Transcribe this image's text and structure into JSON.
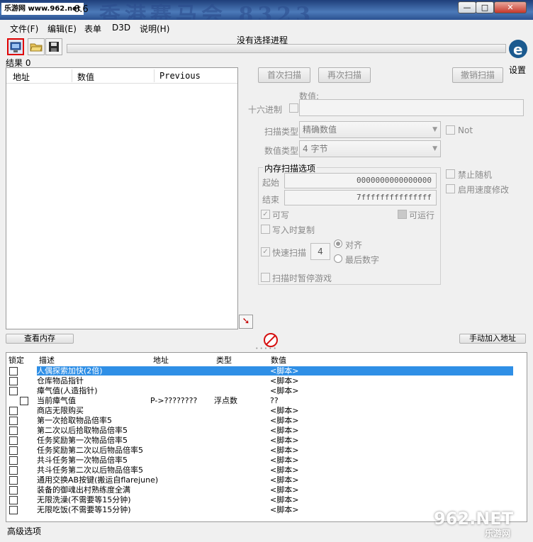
{
  "titlebar": {
    "watermark": "乐游网 www.962.net",
    "version": "6.6",
    "banner": "香港赛马会  8323"
  },
  "window": {
    "min": "—",
    "max": "□",
    "close": "✕"
  },
  "menu": [
    "文件(F)",
    "编辑(E)",
    "表单",
    "D3D",
    "说明(H)"
  ],
  "process_label": "没有选择进程",
  "settings_label": "设置",
  "result_count": "结果 0",
  "scan_list": {
    "col_address": "地址",
    "col_value": "数值",
    "col_previous": "Previous"
  },
  "buttons": {
    "first_scan": "首次扫描",
    "next_scan": "再次扫描",
    "undo_scan": "撤销扫描",
    "view_memory": "查看内存",
    "manual_add": "手动加入地址"
  },
  "scan": {
    "value_label": "数值:",
    "hex_label": "十六进制",
    "scan_type_label": "扫描类型",
    "scan_type_value": "精确数值",
    "value_type_label": "数值类型",
    "value_type_value": "4 字节",
    "not_label": "Not",
    "disable_random": "禁止随机",
    "speedhack": "启用速度修改"
  },
  "memory": {
    "title": "内存扫描选项",
    "start_label": "起始",
    "start_value": "0000000000000000",
    "end_label": "结束",
    "end_value": "7fffffffffffffff",
    "writable": "可写",
    "executable": "可运行",
    "copy_on_write": "写入时复制",
    "fast_scan": "快速扫描",
    "fast_scan_value": "4",
    "align": "对齐",
    "last_digits": "最后数字",
    "pause": "扫描时暂停游戏"
  },
  "cheat_table": {
    "headers": {
      "active": "锁定",
      "description": "描述",
      "address": "地址",
      "type": "类型",
      "value": "数值"
    },
    "rows": [
      {
        "desc": "人偶探索加快(2倍)",
        "addr": "",
        "type": "",
        "val": "<脚本>",
        "selected": true
      },
      {
        "desc": "仓库物品指针",
        "addr": "",
        "type": "",
        "val": "<脚本>"
      },
      {
        "desc": "瘴气值(人造指针)",
        "addr": "",
        "type": "",
        "val": "<脚本>"
      },
      {
        "desc": "当前瘴气值",
        "addr": "P->????????",
        "type": "浮点数",
        "val": "??",
        "indent": true
      },
      {
        "desc": "商店无限购买",
        "addr": "",
        "type": "",
        "val": "<脚本>"
      },
      {
        "desc": "第一次拾取物品倍率5",
        "addr": "",
        "type": "",
        "val": "<脚本>"
      },
      {
        "desc": "第二次以后拾取物品倍率5",
        "addr": "",
        "type": "",
        "val": "<脚本>"
      },
      {
        "desc": "任务奖励第一次物品倍率5",
        "addr": "",
        "type": "",
        "val": "<脚本>"
      },
      {
        "desc": "任务奖励第二次以后物品倍率5",
        "addr": "",
        "type": "",
        "val": "<脚本>"
      },
      {
        "desc": "共斗任务第一次物品倍率5",
        "addr": "",
        "type": "",
        "val": "<脚本>"
      },
      {
        "desc": "共斗任务第二次以后物品倍率5",
        "addr": "",
        "type": "",
        "val": "<脚本>"
      },
      {
        "desc": "通用交换AB按键(搬运自flarejune)",
        "addr": "",
        "type": "",
        "val": "<脚本>"
      },
      {
        "desc": "装备的御魂出村熟练度全满",
        "addr": "",
        "type": "",
        "val": "<脚本>"
      },
      {
        "desc": "无限洗澡(不需要等15分钟)",
        "addr": "",
        "type": "",
        "val": "<脚本>"
      },
      {
        "desc": "无限吃饭(不需要等15分钟)",
        "addr": "",
        "type": "",
        "val": "<脚本>"
      }
    ]
  },
  "advanced_label": "高级选项",
  "site_watermark": {
    "logo": "962.NET",
    "sub": "乐游网"
  }
}
